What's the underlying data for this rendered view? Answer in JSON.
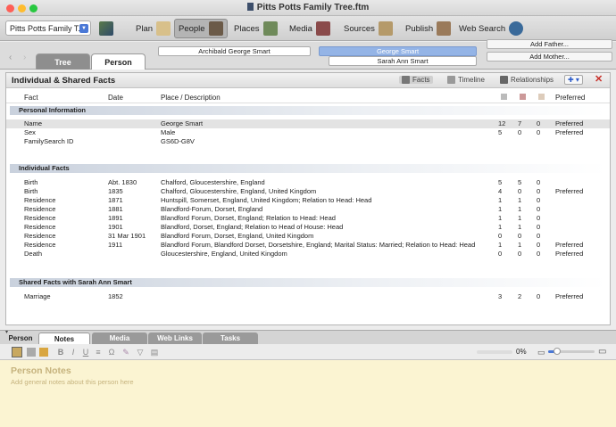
{
  "window": {
    "title": "Pitts Potts Family Tree.ftm"
  },
  "toolbar": {
    "tree_select": "Pitts Potts Family T...",
    "plan": "Plan",
    "people": "People",
    "places": "Places",
    "media": "Media",
    "sources": "Sources",
    "publish": "Publish",
    "web_search": "Web Search"
  },
  "nav": {
    "tab_tree": "Tree",
    "tab_person": "Person",
    "father_parent": "Archibald George Smart",
    "selected_person": "George Smart",
    "spouse": "Sarah Ann Smart",
    "add_father": "Add Father...",
    "add_mother": "Add Mother..."
  },
  "panel": {
    "title": "Individual & Shared Facts",
    "facts_btn": "Facts",
    "timeline_btn": "Timeline",
    "relationships_btn": "Relationships"
  },
  "columns": {
    "fact": "Fact",
    "date": "Date",
    "place": "Place / Description",
    "preferred": "Preferred"
  },
  "sections": [
    {
      "title": "Personal Information",
      "rows": [
        {
          "fact": "Name",
          "date": "",
          "place": "George Smart",
          "n1": "12",
          "n2": "7",
          "n3": "0",
          "pref": "Preferred"
        },
        {
          "fact": "Sex",
          "date": "",
          "place": "Male",
          "n1": "5",
          "n2": "0",
          "n3": "0",
          "pref": "Preferred"
        },
        {
          "fact": "FamilySearch ID",
          "date": "",
          "place": "GS6D-G8V",
          "n1": "",
          "n2": "",
          "n3": "",
          "pref": ""
        }
      ]
    },
    {
      "title": "Individual Facts",
      "rows": [
        {
          "fact": "Birth",
          "date": "Abt. 1830",
          "place": "Chalford, Gloucestershire, England",
          "n1": "5",
          "n2": "5",
          "n3": "0",
          "pref": ""
        },
        {
          "fact": "Birth",
          "date": "1835",
          "place": "Chalford, Gloucestershire, England, United Kingdom",
          "n1": "4",
          "n2": "0",
          "n3": "0",
          "pref": "Preferred"
        },
        {
          "fact": "Residence",
          "date": "1871",
          "place": "Huntspill, Somerset, England, United Kingdom; Relation to Head: Head",
          "n1": "1",
          "n2": "1",
          "n3": "0",
          "pref": ""
        },
        {
          "fact": "Residence",
          "date": "1881",
          "place": "Blandford-Forum, Dorset, England",
          "n1": "1",
          "n2": "1",
          "n3": "0",
          "pref": ""
        },
        {
          "fact": "Residence",
          "date": "1891",
          "place": "Blandford Forum, Dorset, England; Relation to Head: Head",
          "n1": "1",
          "n2": "1",
          "n3": "0",
          "pref": ""
        },
        {
          "fact": "Residence",
          "date": "1901",
          "place": "Blandford, Dorset, England; Relation to Head of House: Head",
          "n1": "1",
          "n2": "1",
          "n3": "0",
          "pref": ""
        },
        {
          "fact": "Residence",
          "date": "31 Mar 1901",
          "place": "Blandford Forum, Dorset, England, United Kingdom",
          "n1": "0",
          "n2": "0",
          "n3": "0",
          "pref": ""
        },
        {
          "fact": "Residence",
          "date": "1911",
          "place": "Blandford Forum, Blandford Dorset, Dorsetshire, England; Marital Status: Married; Relation to Head: Head",
          "n1": "1",
          "n2": "1",
          "n3": "0",
          "pref": "Preferred"
        },
        {
          "fact": "Death",
          "date": "",
          "place": "Gloucestershire, England, United Kingdom",
          "n1": "0",
          "n2": "0",
          "n3": "0",
          "pref": "Preferred"
        }
      ]
    },
    {
      "title": "Shared Facts with Sarah Ann Smart",
      "rows": [
        {
          "fact": "Marriage",
          "date": "1852",
          "place": "",
          "n1": "3",
          "n2": "2",
          "n3": "0",
          "pref": "Preferred"
        }
      ]
    }
  ],
  "lower_tabs": {
    "person": "Person",
    "notes": "Notes",
    "media": "Media",
    "web_links": "Web Links",
    "tasks": "Tasks"
  },
  "editor": {
    "zoom": "0%",
    "zoom_level": 0.2
  },
  "notes": {
    "heading": "Person Notes",
    "placeholder": "Add general notes about this person here"
  },
  "colors": {
    "accent": "#4a78d6",
    "notes_bg": "#fbf4d2",
    "section_band": "#c9d1dd",
    "close_red": "#c8302a"
  }
}
